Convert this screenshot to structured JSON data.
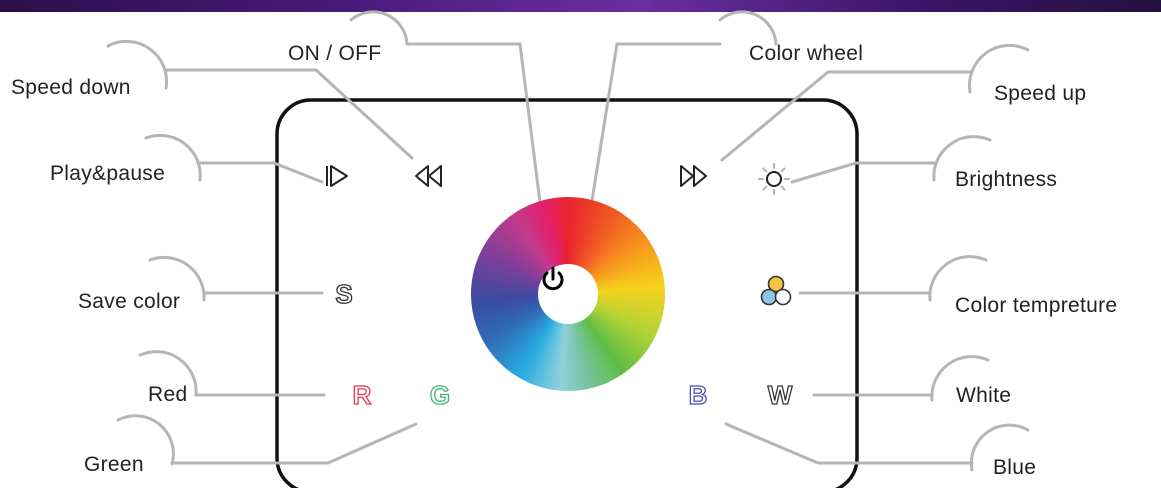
{
  "labels": {
    "on_off": "ON / OFF",
    "color_wheel": "Color wheel",
    "speed_down": "Speed down",
    "speed_up": "Speed up",
    "play_pause": "Play&pause",
    "brightness": "Brightness",
    "save_color": "Save color",
    "color_temperature": "Color tempreture",
    "red": "Red",
    "white": "White",
    "green": "Green",
    "blue": "Blue"
  },
  "buttons": {
    "save": "S",
    "red": "R",
    "green": "G",
    "blue": "B",
    "white": "W"
  },
  "colors": {
    "red": "#e8344e",
    "green": "#3cb878",
    "blue": "#4a4fb0",
    "white": "#333333",
    "panel_border": "#111111",
    "callout_line": "#b5b5b5",
    "temp_warm": "#f5c342",
    "temp_cool": "#8fc6e8"
  },
  "icons": {
    "play_pause": "play-pause-icon",
    "rewind": "rewind-icon",
    "fast_forward": "fast-forward-icon",
    "brightness": "sun-icon",
    "color_temperature": "three-circles-icon",
    "power": "power-icon"
  }
}
